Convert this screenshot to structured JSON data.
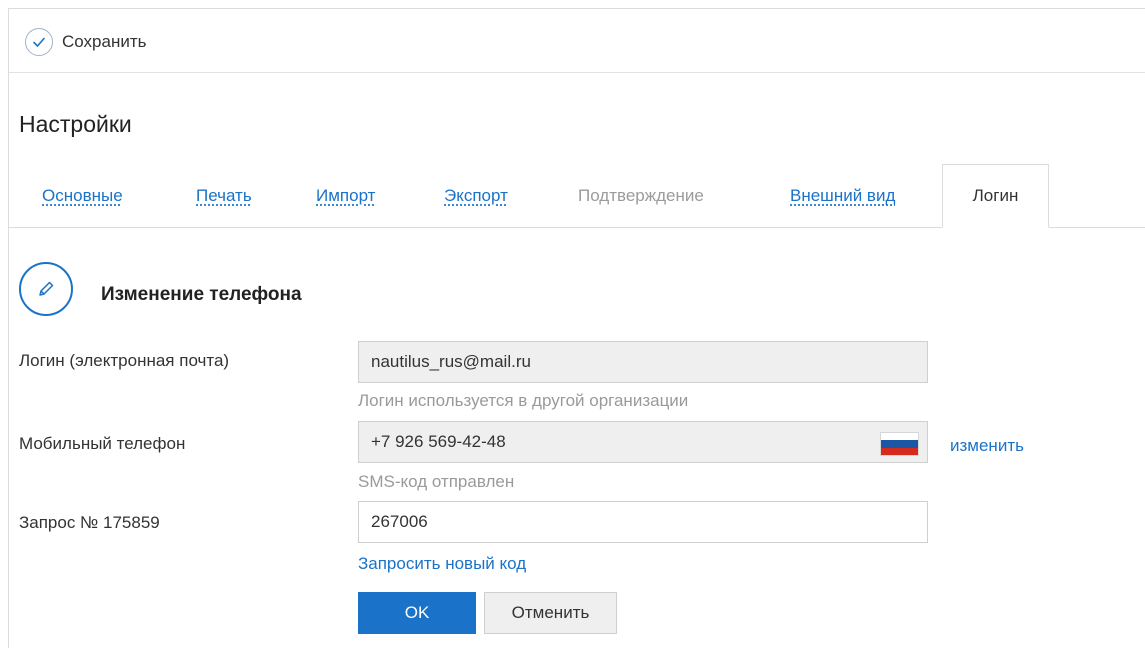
{
  "toolbar": {
    "save_label": "Сохранить"
  },
  "page": {
    "title": "Настройки"
  },
  "tabs": [
    {
      "label": "Основные",
      "state": "link"
    },
    {
      "label": "Печать",
      "state": "link"
    },
    {
      "label": "Импорт",
      "state": "link"
    },
    {
      "label": "Экспорт",
      "state": "link"
    },
    {
      "label": "Подтверждение",
      "state": "disabled"
    },
    {
      "label": "Внешний вид",
      "state": "link"
    },
    {
      "label": "Логин",
      "state": "active"
    }
  ],
  "section": {
    "title": "Изменение телефона",
    "icon": "pencil-icon"
  },
  "form": {
    "login": {
      "label": "Логин (электронная почта)",
      "value": "nautilus_rus@mail.ru",
      "hint": "Логин используется в другой организации"
    },
    "phone": {
      "label": "Мобильный телефон",
      "value": "+7 926 569-42-48",
      "flag": "russia-flag-icon",
      "change_link": "изменить",
      "hint": "SMS-код отправлен"
    },
    "request": {
      "label": "Запрос № 175859",
      "value": "267006",
      "new_code_link": "Запросить новый код"
    }
  },
  "buttons": {
    "ok": "OK",
    "cancel": "Отменить"
  },
  "colors": {
    "accent": "#1a73c8",
    "disabled_text": "#9b9b9b",
    "readonly_bg": "#efefef"
  }
}
